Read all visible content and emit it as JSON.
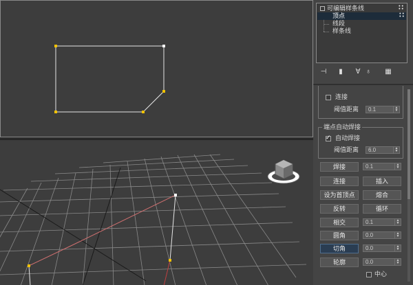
{
  "modifier_stack": {
    "title": "可编辑样条线",
    "items": [
      {
        "label": "顶点",
        "selected": true
      },
      {
        "label": "线段",
        "selected": false
      },
      {
        "label": "样条线",
        "selected": false
      }
    ]
  },
  "toolbar_icons": [
    "pin-stack-icon",
    "show-end-result-icon",
    "make-unique-icon",
    "remove-modifier-icon",
    "configure-modifier-sets-icon"
  ],
  "connect_group": {
    "checkbox_label": "连接",
    "checked": false,
    "threshold_label": "阈值距离",
    "threshold_value": "0.1"
  },
  "auto_weld_group": {
    "title": "端点自动焊接",
    "checkbox_label": "自动焊接",
    "checked": true,
    "threshold_label": "阈值距离",
    "threshold_value": "6.0"
  },
  "geometry_buttons": {
    "weld_label": "焊接",
    "weld_value": "0.1",
    "connect_label": "连接",
    "insert_label": "插入",
    "make_first_label": "设为首顶点",
    "fuse_label": "熔合",
    "reverse_label": "反转",
    "cycle_label": "循环",
    "cross_insert_label": "相交",
    "cross_insert_value": "0.1",
    "fillet_label": "圆角",
    "fillet_value": "0.0",
    "chamfer_label": "切角",
    "chamfer_value": "0.0",
    "outline_label": "轮廓",
    "outline_value": "0.0",
    "center_label": "中心",
    "center_checked": false
  },
  "colors": {
    "viewport_bg": "#3d3d3d",
    "panel_bg": "#444444",
    "vertex_yellow": "#f2c200",
    "spline_white": "#e8e8e8",
    "selection_blue": "#1d2c3a"
  }
}
